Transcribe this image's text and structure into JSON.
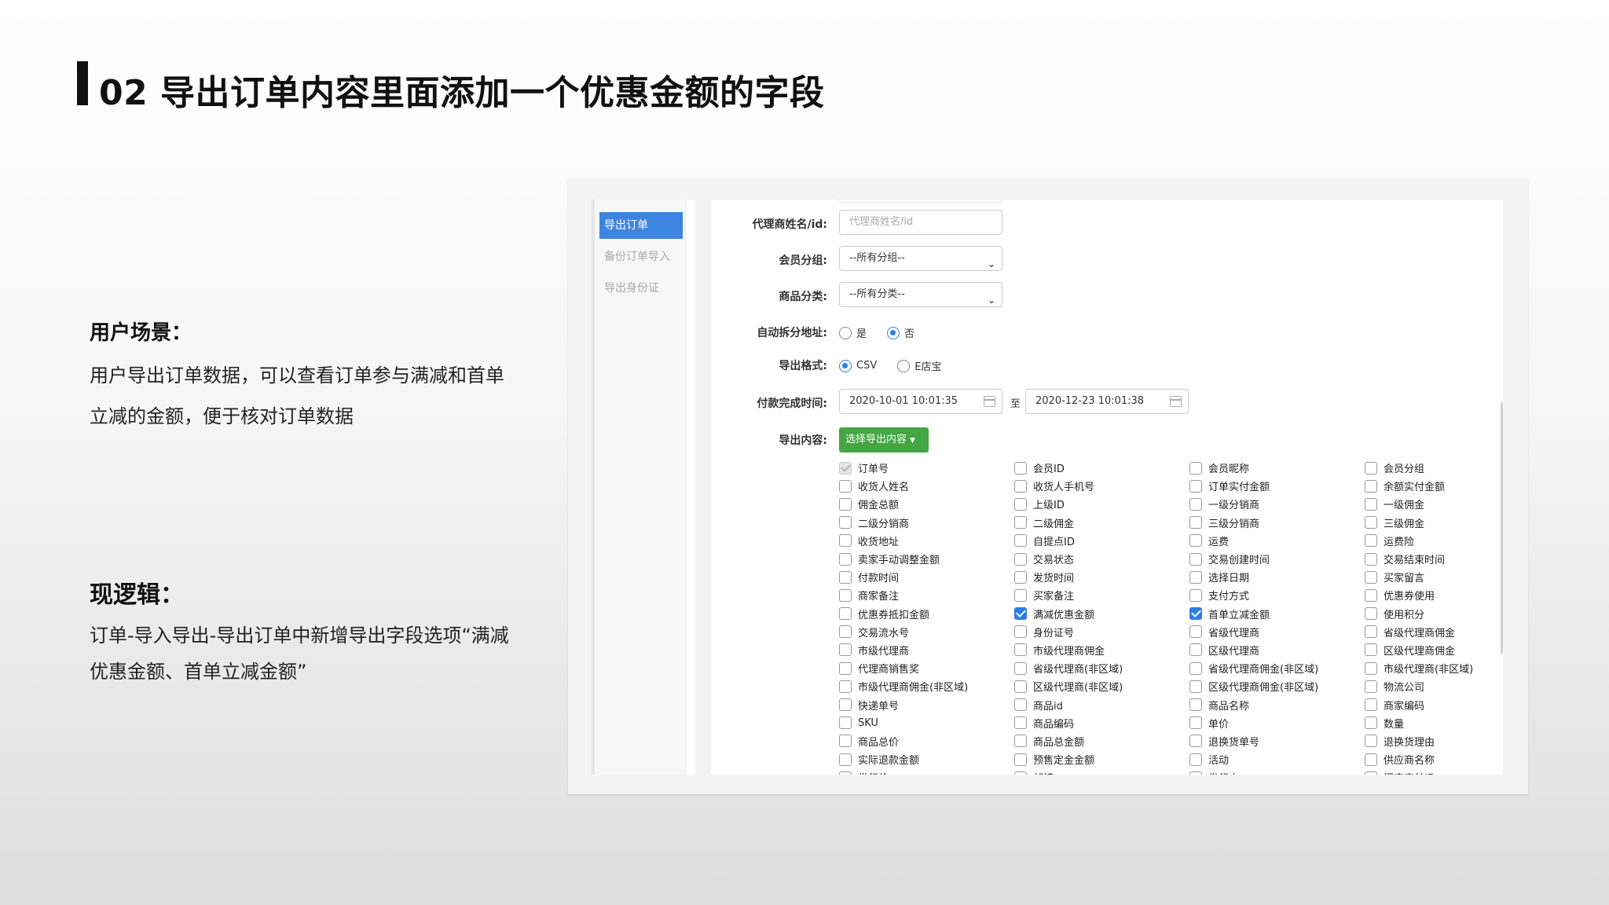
{
  "slide": {
    "title": "02 导出订单内容里面添加一个优惠金额的字段"
  },
  "scenario": {
    "heading": "用户场景：",
    "body": "用户导出订单数据，可以查看订单参与满减和首单立减的金额，便于核对订单数据"
  },
  "logic": {
    "heading": "现逻辑：",
    "body": "订单-导入导出-导出订单中新增导出字段选项“满减优惠金额、首单立减金额”"
  },
  "app": {
    "nav": [
      "导出订单",
      "备份订单导入",
      "导出身份证"
    ],
    "form": {
      "agent_label": "代理商姓名/id:",
      "agent_placeholder": "代理商姓名/id",
      "member_group_label": "会员分组:",
      "member_group_value": "--所有分组--",
      "category_label": "商品分类:",
      "category_value": "--所有分类--",
      "split_label": "自动拆分地址:",
      "split_yes": "是",
      "split_no": "否",
      "format_label": "导出格式:",
      "format_csv": "CSV",
      "format_e": "E店宝",
      "paytime_label": "付款完成时间:",
      "date_from": "2020-10-01 10:01:35",
      "date_to_label": "至",
      "date_to": "2020-12-23 10:01:38",
      "content_label": "导出内容:",
      "content_button": "选择导出内容"
    },
    "fields": [
      {
        "label": "订单号",
        "state": "disabled"
      },
      {
        "label": "会员ID",
        "state": "off"
      },
      {
        "label": "会员昵称",
        "state": "off"
      },
      {
        "label": "会员分组",
        "state": "off"
      },
      {
        "label": "收货人姓名",
        "state": "off"
      },
      {
        "label": "收货人手机号",
        "state": "off"
      },
      {
        "label": "订单实付金额",
        "state": "off"
      },
      {
        "label": "余额实付金额",
        "state": "off"
      },
      {
        "label": "佣金总额",
        "state": "off"
      },
      {
        "label": "上级ID",
        "state": "off"
      },
      {
        "label": "一级分销商",
        "state": "off"
      },
      {
        "label": "一级佣金",
        "state": "off"
      },
      {
        "label": "二级分销商",
        "state": "off"
      },
      {
        "label": "二级佣金",
        "state": "off"
      },
      {
        "label": "三级分销商",
        "state": "off"
      },
      {
        "label": "三级佣金",
        "state": "off"
      },
      {
        "label": "收货地址",
        "state": "off"
      },
      {
        "label": "自提点ID",
        "state": "off"
      },
      {
        "label": "运费",
        "state": "off"
      },
      {
        "label": "运费险",
        "state": "off"
      },
      {
        "label": "卖家手动调整金额",
        "state": "off"
      },
      {
        "label": "交易状态",
        "state": "off"
      },
      {
        "label": "交易创建时间",
        "state": "off"
      },
      {
        "label": "交易结束时间",
        "state": "off"
      },
      {
        "label": "付款时间",
        "state": "off"
      },
      {
        "label": "发货时间",
        "state": "off"
      },
      {
        "label": "选择日期",
        "state": "off"
      },
      {
        "label": "买家留言",
        "state": "off"
      },
      {
        "label": "商家备注",
        "state": "off"
      },
      {
        "label": "买家备注",
        "state": "off"
      },
      {
        "label": "支付方式",
        "state": "off"
      },
      {
        "label": "优惠券使用",
        "state": "off"
      },
      {
        "label": "优惠券抵扣金额",
        "state": "off"
      },
      {
        "label": "满减优惠金额",
        "state": "on"
      },
      {
        "label": "首单立减金额",
        "state": "on"
      },
      {
        "label": "使用积分",
        "state": "off"
      },
      {
        "label": "交易流水号",
        "state": "off"
      },
      {
        "label": "身份证号",
        "state": "off"
      },
      {
        "label": "省级代理商",
        "state": "off"
      },
      {
        "label": "省级代理商佣金",
        "state": "off"
      },
      {
        "label": "市级代理商",
        "state": "off"
      },
      {
        "label": "市级代理商佣金",
        "state": "off"
      },
      {
        "label": "区级代理商",
        "state": "off"
      },
      {
        "label": "区级代理商佣金",
        "state": "off"
      },
      {
        "label": "代理商销售奖",
        "state": "off"
      },
      {
        "label": "省级代理商(非区域)",
        "state": "off"
      },
      {
        "label": "省级代理商佣金(非区域)",
        "state": "off"
      },
      {
        "label": "市级代理商(非区域)",
        "state": "off"
      },
      {
        "label": "市级代理商佣金(非区域)",
        "state": "off"
      },
      {
        "label": "区级代理商(非区域)",
        "state": "off"
      },
      {
        "label": "区级代理商佣金(非区域)",
        "state": "off"
      },
      {
        "label": "物流公司",
        "state": "off"
      },
      {
        "label": "快递单号",
        "state": "off"
      },
      {
        "label": "商品id",
        "state": "off"
      },
      {
        "label": "商品名称",
        "state": "off"
      },
      {
        "label": "商家编码",
        "state": "off"
      },
      {
        "label": "SKU",
        "state": "off"
      },
      {
        "label": "商品编码",
        "state": "off"
      },
      {
        "label": "单价",
        "state": "off"
      },
      {
        "label": "数量",
        "state": "off"
      },
      {
        "label": "商品总价",
        "state": "off"
      },
      {
        "label": "商品总金额",
        "state": "off"
      },
      {
        "label": "退换货单号",
        "state": "off"
      },
      {
        "label": "退换货理由",
        "state": "off"
      },
      {
        "label": "实际退款金额",
        "state": "off"
      },
      {
        "label": "预售定金金额",
        "state": "off"
      },
      {
        "label": "活动",
        "state": "off"
      },
      {
        "label": "供应商名称",
        "state": "off"
      },
      {
        "label": "供货价",
        "state": "off"
      },
      {
        "label": "邮编",
        "state": "off"
      },
      {
        "label": "发货人",
        "state": "off"
      },
      {
        "label": "门店店长ID",
        "state": "off"
      }
    ]
  }
}
